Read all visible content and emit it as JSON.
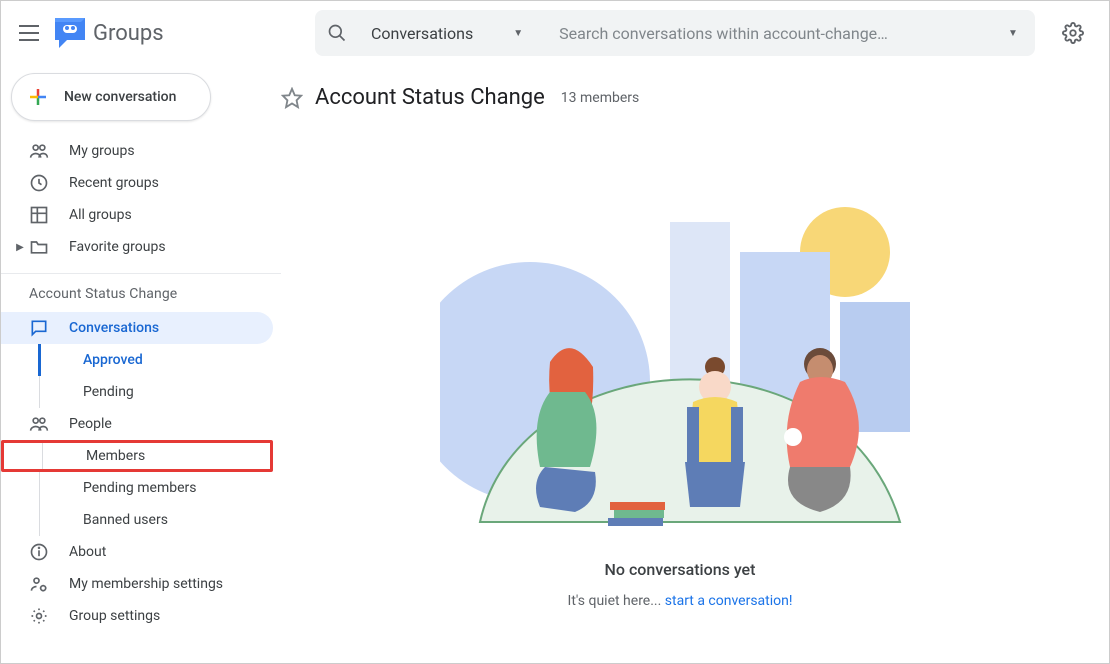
{
  "header": {
    "app_name": "Groups",
    "scope_label": "Conversations",
    "search_placeholder": "Search conversations within account-change…"
  },
  "sidebar": {
    "new_button": "New conversation",
    "top_nav": [
      {
        "label": "My groups",
        "icon": "people-icon"
      },
      {
        "label": "Recent groups",
        "icon": "clock-icon"
      },
      {
        "label": "All groups",
        "icon": "grid-icon"
      },
      {
        "label": "Favorite groups",
        "icon": "folder-icon",
        "expandable": true
      }
    ],
    "group_section_label": "Account Status Change",
    "group_nav": {
      "conversations": "Conversations",
      "approved": "Approved",
      "pending": "Pending",
      "people": "People",
      "members": "Members",
      "pending_members": "Pending members",
      "banned": "Banned users",
      "about": "About",
      "membership_settings": "My membership settings",
      "group_settings": "Group settings"
    }
  },
  "main": {
    "group_title": "Account Status Change",
    "member_count": "13 members",
    "empty_title": "No conversations yet",
    "empty_prefix": "It's quiet here... ",
    "empty_link": "start a conversation!"
  }
}
